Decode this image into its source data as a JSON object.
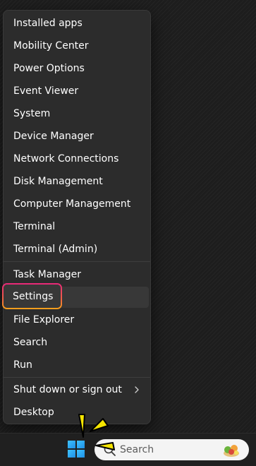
{
  "menu": {
    "groups": [
      {
        "items": [
          {
            "label": "Installed apps"
          },
          {
            "label": "Mobility Center"
          },
          {
            "label": "Power Options"
          },
          {
            "label": "Event Viewer"
          },
          {
            "label": "System"
          },
          {
            "label": "Device Manager"
          },
          {
            "label": "Network Connections"
          },
          {
            "label": "Disk Management"
          },
          {
            "label": "Computer Management"
          },
          {
            "label": "Terminal"
          },
          {
            "label": "Terminal (Admin)"
          }
        ]
      },
      {
        "items": [
          {
            "label": "Task Manager"
          },
          {
            "label": "Settings",
            "highlighted": true
          },
          {
            "label": "File Explorer"
          },
          {
            "label": "Search"
          },
          {
            "label": "Run"
          }
        ]
      },
      {
        "items": [
          {
            "label": "Shut down or sign out",
            "has_submenu": true
          },
          {
            "label": "Desktop"
          }
        ]
      }
    ]
  },
  "taskbar": {
    "start_icon": "windows-logo-icon",
    "search": {
      "placeholder": "Search",
      "icon": "search-icon"
    }
  },
  "colors": {
    "menu_bg": "#2c2c2c",
    "text": "#ffffff",
    "highlight_gradient_start": "#e8287a",
    "highlight_gradient_end": "#f7a21a",
    "marker": "#f5e500",
    "start_blue": "#1e90e6"
  }
}
